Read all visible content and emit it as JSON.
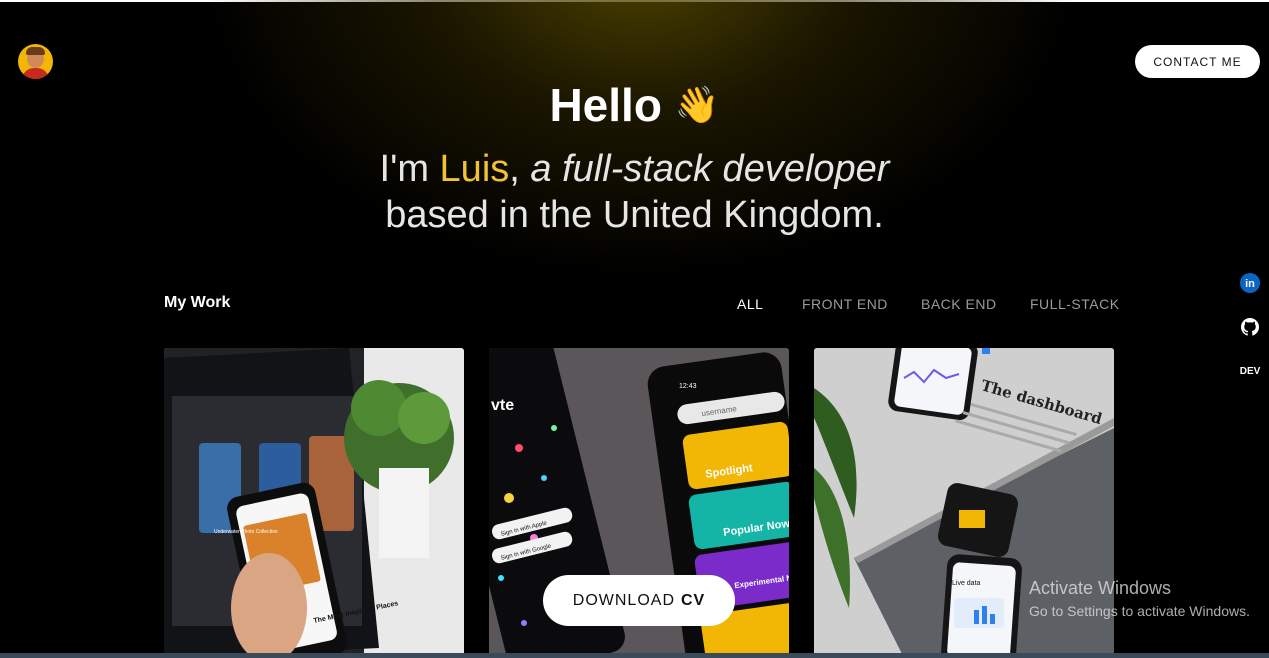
{
  "header": {
    "contact_label": "CONTACT ME"
  },
  "hero": {
    "greeting": "Hello",
    "wave_emoji": "👋",
    "intro_prefix": "I'm ",
    "name": "Luis",
    "intro_comma": ",",
    "role": "a full-stack developer",
    "location_line": "based in the United Kingdom."
  },
  "work": {
    "title": "My Work",
    "filters": [
      "ALL",
      "FRONT END",
      "BACK END",
      "FULL-STACK"
    ],
    "active_filter": "ALL"
  },
  "cards": {
    "card1": {
      "phone_title": "The Most Inspiring Places",
      "screen_text": "Underwater Photo Collection"
    },
    "card2": {
      "search_placeholder": "username",
      "time": "12:43",
      "tile1": "Spotlight",
      "tile2": "Popular Now",
      "tile3": "Experimental New & Trending",
      "apple_btn": "Sign in with Apple",
      "google_btn": "Sign in with Google",
      "logo_text": "vte"
    },
    "card3": {
      "heading": "The dashboard",
      "phone_label": "Live data"
    }
  },
  "download": {
    "label": "DOWNLOAD",
    "label_bold": "CV"
  },
  "social": {
    "linkedin": "in",
    "devto": "DEV"
  },
  "watermark": {
    "title": "Activate Windows",
    "subtitle": "Go to Settings to activate Windows."
  },
  "colors": {
    "accent": "#f2c230",
    "background": "#000000",
    "linkedin": "#0a66c2"
  }
}
